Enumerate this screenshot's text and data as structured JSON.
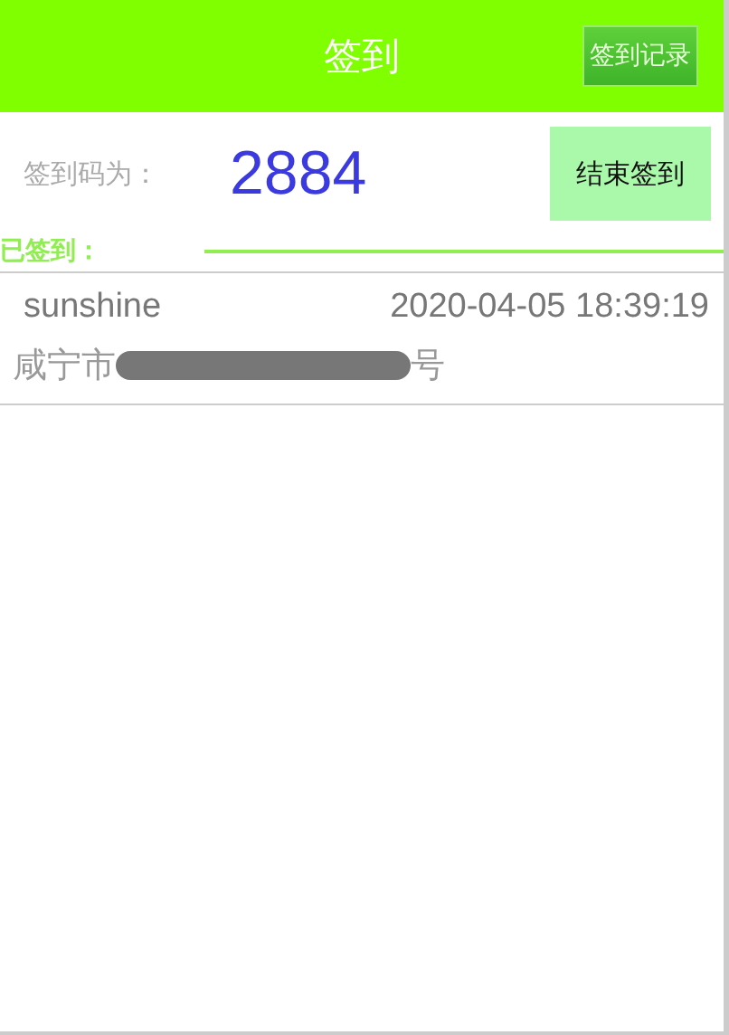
{
  "header": {
    "title": "签到",
    "record_button": "签到记录"
  },
  "code": {
    "label": "签到码为：",
    "value": "2884",
    "end_button": "结束签到"
  },
  "signed_section": {
    "label": "已签到："
  },
  "records": [
    {
      "name": "sunshine",
      "time": "2020-04-05 18:39:19",
      "address_start": "咸宁市",
      "address_end": "号",
      "redacted": true
    }
  ]
}
